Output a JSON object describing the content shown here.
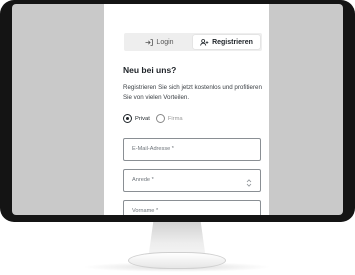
{
  "tabs": [
    {
      "label": "Login",
      "icon": "login-icon",
      "active": false
    },
    {
      "label": "Registrieren",
      "icon": "add-user-icon",
      "active": true
    }
  ],
  "heading": "Neu bei uns?",
  "intro": "Registrieren Sie sich jetzt kostenlos und profitieren Sie von vielen Vorteilen.",
  "customer_type": {
    "options": [
      "Privat",
      "Firma"
    ],
    "selected": "Privat"
  },
  "fields": {
    "email_placeholder": "E-Mail-Adresse *",
    "salutation_placeholder": "Anrede *",
    "firstname_placeholder": "Vorname *"
  },
  "colors": {
    "bezel": "#141414",
    "frame": "#c9c9c9",
    "text": "#1e2328",
    "tab_bg": "#eeeeee"
  }
}
